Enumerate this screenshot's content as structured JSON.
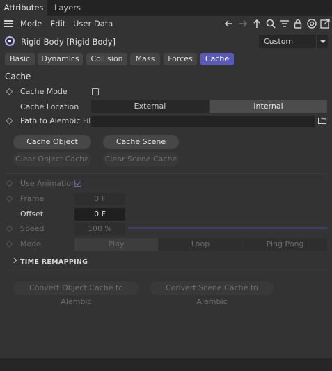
{
  "tabs": [
    {
      "label": "Attributes",
      "active": true
    },
    {
      "label": "Layers",
      "active": false
    }
  ],
  "menu": {
    "items": [
      "Mode",
      "Edit",
      "User Data"
    ]
  },
  "toolbar_icons": [
    "back-arrow-icon",
    "forward-arrow-icon",
    "up-arrow-icon",
    "search-icon",
    "filter-icon",
    "lock-icon",
    "target-icon",
    "new-window-icon"
  ],
  "object": {
    "title": "Rigid Body [Rigid Body]",
    "preset": "Custom"
  },
  "subtabs": [
    {
      "label": "Basic",
      "active": false
    },
    {
      "label": "Dynamics",
      "active": false
    },
    {
      "label": "Collision",
      "active": false
    },
    {
      "label": "Mass",
      "active": false
    },
    {
      "label": "Forces",
      "active": false
    },
    {
      "label": "Cache",
      "active": true
    }
  ],
  "cache": {
    "section_title": "Cache",
    "cache_mode_label": "Cache Mode",
    "cache_mode_checked": false,
    "cache_location_label": "Cache Location",
    "location_options": [
      "External",
      "Internal"
    ],
    "location_selected": "Internal",
    "path_label": "Path to Alembic File",
    "path_value": "",
    "cache_object_btn": "Cache Object",
    "cache_scene_btn": "Cache Scene",
    "clear_object_btn": "Clear Object Cache",
    "clear_scene_btn": "Clear Scene Cache",
    "use_animation_label": "Use Animation",
    "use_animation_checked": true,
    "frame_label": "Frame",
    "frame_value": "0 F",
    "offset_label": "Offset",
    "offset_value": "0 F",
    "speed_label": "Speed",
    "speed_value": "100 %",
    "mode_label": "Mode",
    "mode_options": [
      "Play",
      "Loop",
      "Ping Pong"
    ],
    "mode_selected": "Play",
    "time_remapping_title": "TIME REMAPPING",
    "convert_object_btn": "Convert Object Cache to Alembic",
    "convert_scene_btn": "Convert Scene Cache to Alembic"
  },
  "colors": {
    "accent": "#5a58b8",
    "background": "#333333"
  }
}
